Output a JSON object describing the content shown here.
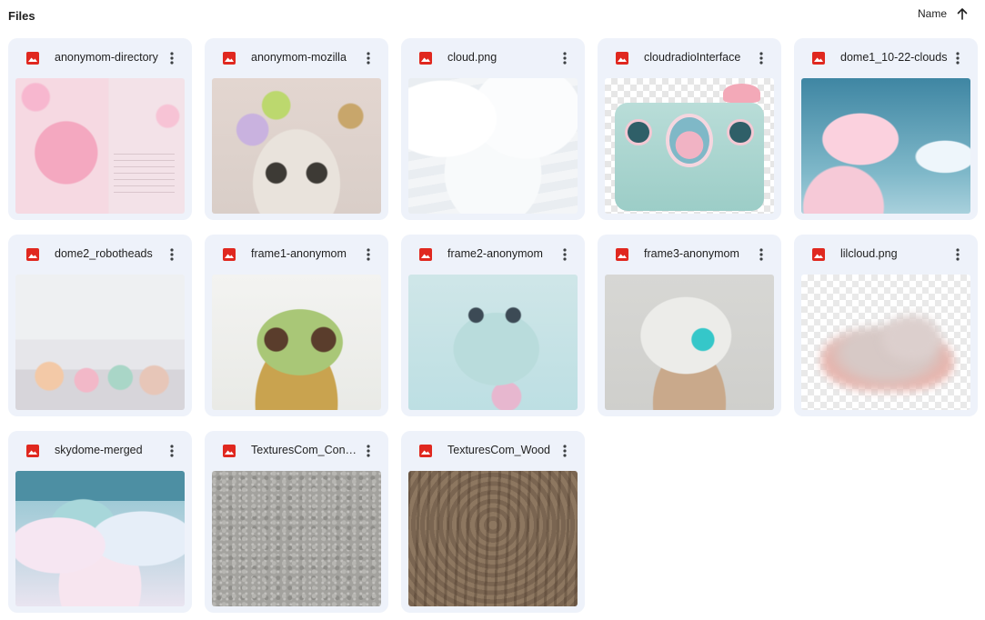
{
  "header": {
    "title": "Files",
    "sort_label": "Name",
    "sort_icon": "arrow-up-icon"
  },
  "colors": {
    "card_background": "#eef2fa",
    "image_icon": "#e0281f"
  },
  "files": [
    {
      "name": "anonymom-directory",
      "icon": "image-file-icon"
    },
    {
      "name": "anonymom-mozilla",
      "icon": "image-file-icon"
    },
    {
      "name": "cloud.png",
      "icon": "image-file-icon"
    },
    {
      "name": "cloudradioInterface",
      "icon": "image-file-icon"
    },
    {
      "name": "dome1_10-22-clouds",
      "icon": "image-file-icon"
    },
    {
      "name": "dome2_robotheads",
      "icon": "image-file-icon"
    },
    {
      "name": "frame1-anonymom",
      "icon": "image-file-icon"
    },
    {
      "name": "frame2-anonymom",
      "icon": "image-file-icon"
    },
    {
      "name": "frame3-anonymom",
      "icon": "image-file-icon"
    },
    {
      "name": "lilcloud.png",
      "icon": "image-file-icon"
    },
    {
      "name": "skydome-merged",
      "icon": "image-file-icon"
    },
    {
      "name": "TexturesCom_Concrete",
      "icon": "image-file-icon"
    },
    {
      "name": "TexturesCom_Wood",
      "icon": "image-file-icon"
    }
  ]
}
